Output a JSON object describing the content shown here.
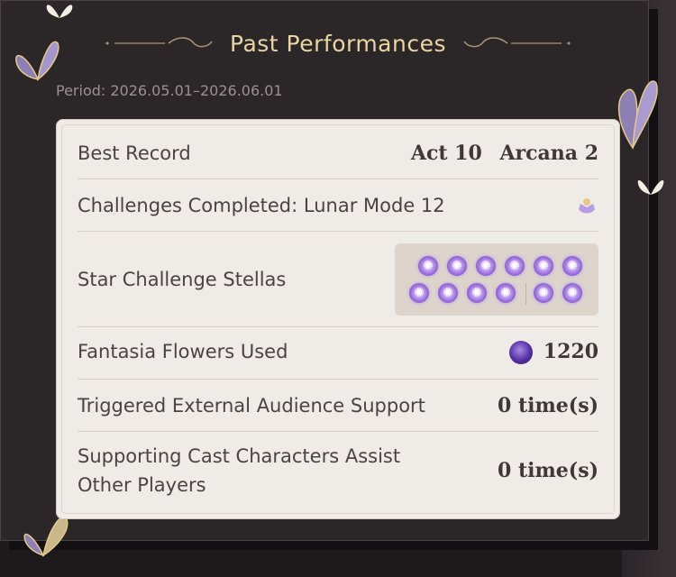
{
  "header": {
    "title": "Past Performances",
    "period": "Period: 2026.05.01–2026.06.01"
  },
  "rows": {
    "best_record": {
      "label": "Best Record",
      "act": "Act 10",
      "arcana": "Arcana 2"
    },
    "challenges": {
      "label": "Challenges Completed: Lunar Mode 12",
      "icon": "lunar-mode-icon"
    },
    "stellas": {
      "label": "Star Challenge Stellas",
      "count_shown": 12,
      "icon": "stella-icon"
    },
    "flowers": {
      "label": "Fantasia Flowers Used",
      "value": "1220",
      "icon": "fantasia-flower-icon"
    },
    "external_support": {
      "label": "Triggered External Audience Support",
      "value": "0 time(s)"
    },
    "cast_assist": {
      "label_line1": "Supporting Cast Characters Assist",
      "label_line2": "Other Players",
      "value": "0 time(s)"
    }
  },
  "colors": {
    "title": "#e9d4a2",
    "card_bg": "#efebe6",
    "stella_purple": "#9b6ee0",
    "text": "#4a4346"
  }
}
